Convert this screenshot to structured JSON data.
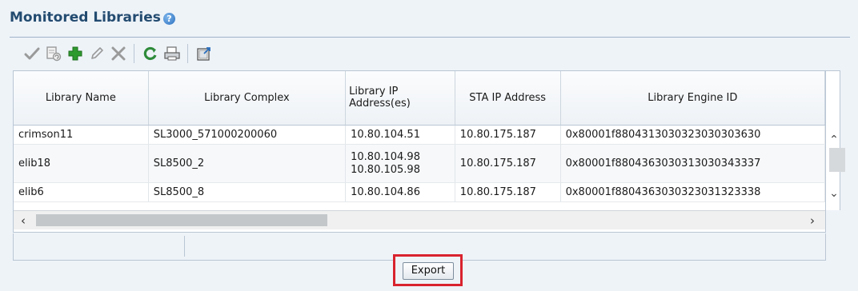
{
  "panel": {
    "title": "Monitored Libraries",
    "help_icon": "?"
  },
  "toolbar": {
    "buttons": [
      {
        "name": "check-icon"
      },
      {
        "name": "refresh-config-icon"
      },
      {
        "name": "add-icon"
      },
      {
        "name": "edit-pencil-icon"
      },
      {
        "name": "delete-x-icon"
      },
      {
        "name": "refresh-icon"
      },
      {
        "name": "print-icon"
      },
      {
        "name": "detach-icon"
      }
    ]
  },
  "table": {
    "columns": [
      "Library Name",
      "Library Complex",
      "Library IP Address(es)",
      "STA IP Address",
      "Library Engine ID"
    ],
    "rows": [
      {
        "name": "crimson11",
        "complex": "SL3000_571000200060",
        "ip": [
          "10.80.104.51"
        ],
        "sta_ip": "10.80.175.187",
        "engine_id": "0x80001f8804313030323030303630"
      },
      {
        "name": "elib18",
        "complex": "SL8500_2",
        "ip": [
          "10.80.104.98",
          "10.80.105.98"
        ],
        "sta_ip": "10.80.175.187",
        "engine_id": "0x80001f8804363030313030343337"
      },
      {
        "name": "elib6",
        "complex": "SL8500_8",
        "ip": [
          "10.80.104.86"
        ],
        "sta_ip": "10.80.175.187",
        "engine_id": "0x80001f8804363030323031323338"
      }
    ]
  },
  "actions": {
    "export_label": "Export"
  },
  "colors": {
    "title": "#234b70",
    "highlight": "#d9232e",
    "add_green": "#2e9a2e",
    "refresh_green": "#2e8b3a"
  }
}
